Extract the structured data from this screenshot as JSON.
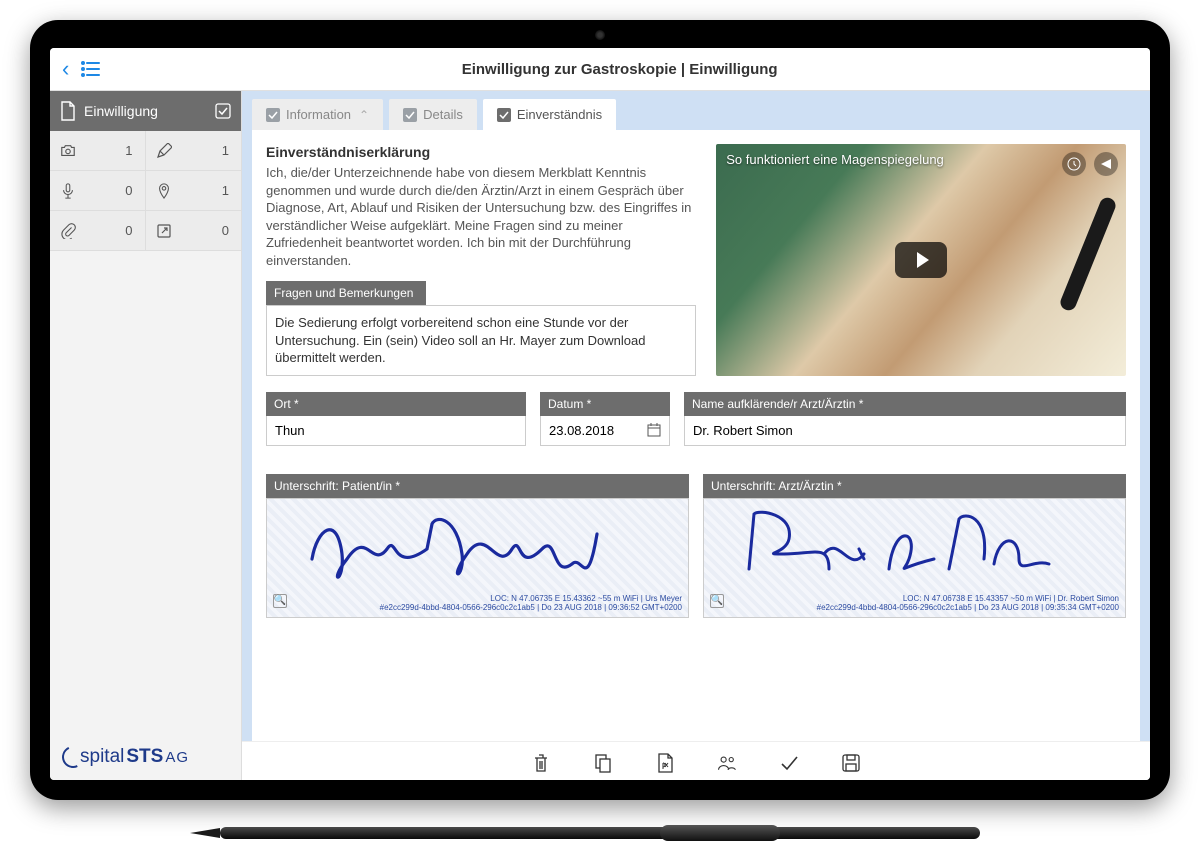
{
  "header": {
    "title": "Einwilligung zur Gastroskopie | Einwilligung"
  },
  "sidebar": {
    "title": "Einwilligung",
    "counts": {
      "camera": "1",
      "pencil": "1",
      "mic": "0",
      "pin": "1",
      "attach": "0",
      "open": "0"
    },
    "logo": {
      "part1": "spital",
      "part2": "STS",
      "part3": "AG"
    }
  },
  "tabs": {
    "info": "Information",
    "details": "Details",
    "consent": "Einverständnis"
  },
  "consent": {
    "heading": "Einverständniserklärung",
    "body": "Ich, die/der Unterzeichnende habe von diesem Merkblatt Kenntnis genommen und wurde durch die/den Ärztin/Arzt in einem Gespräch über Diagnose, Art, Ablauf und Risiken der Untersuchung bzw. des Eingriffes in verständlicher Weise aufgeklärt. Meine Fragen sind zu meiner Zufriedenheit beantwortet worden. Ich bin mit der Durchführung einverstanden.",
    "remarks_label": "Fragen und Bemerkungen",
    "remarks_value": "Die Sedierung erfolgt vorbereitend schon eine Stunde vor der Untersuchung. Ein (sein) Video soll an Hr. Mayer zum Download übermittelt werden.",
    "video_title": "So funktioniert eine Magenspiegelung"
  },
  "fields": {
    "ort_label": "Ort *",
    "ort_value": "Thun",
    "datum_label": "Datum *",
    "datum_value": "23.08.2018",
    "arzt_label": "Name aufklärende/r Arzt/Ärztin *",
    "arzt_value": "Dr. Robert Simon"
  },
  "signatures": {
    "patient_label": "Unterschrift: Patient/in *",
    "doctor_label": "Unterschrift: Arzt/Ärztin *",
    "patient_meta_1": "LOC: N 47.06735  E 15.43362  ~55 m  WiFi  |  Urs Meyer",
    "patient_meta_2": "#e2cc299d-4bbd-4804-0566-296c0c2c1ab5  |  Do 23 AUG 2018  |  09:36:52 GMT+0200",
    "doctor_meta_1": "LOC: N 47.06738  E 15.43357  ~50 m  WiFi  |  Dr. Robert Simon",
    "doctor_meta_2": "#e2cc299d-4bbd-4804-0566-296c0c2c1ab5  |  Do 23 AUG 2018  |  09:35:34 GMT+0200"
  }
}
